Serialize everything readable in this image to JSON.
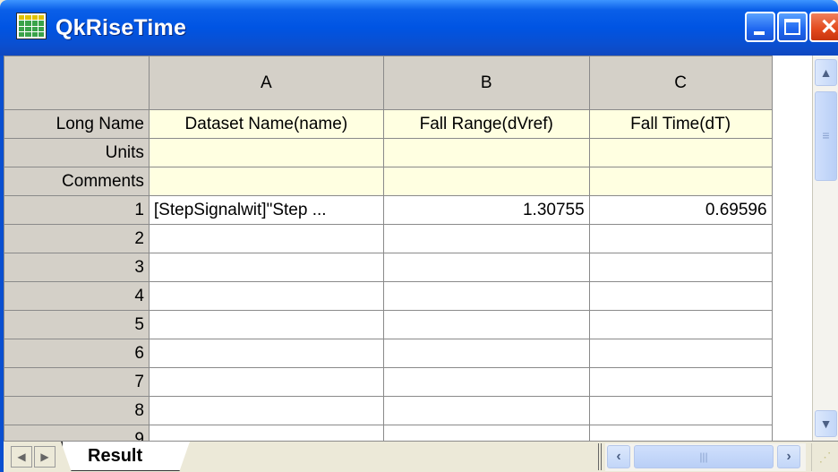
{
  "window": {
    "title": "QkRiseTime",
    "icon": "worksheet-icon",
    "controls": {
      "minimize": "minimize-icon",
      "maximize": "maximize-icon",
      "close": "close-icon",
      "close_glyph": "✕"
    }
  },
  "columns": [
    {
      "letter": "A",
      "long_name": "Dataset Name(name)",
      "units": "",
      "comments": ""
    },
    {
      "letter": "B",
      "long_name": "Fall Range(dVref)",
      "units": "",
      "comments": ""
    },
    {
      "letter": "C",
      "long_name": "Fall Time(dT)",
      "units": "",
      "comments": ""
    }
  ],
  "row_labels": {
    "long_name": "Long Name",
    "units": "Units",
    "comments": "Comments"
  },
  "rows": [
    {
      "index": "1",
      "cells": [
        "[StepSignalwit]\"Step ...",
        "1.30755",
        "0.69596"
      ]
    },
    {
      "index": "2",
      "cells": [
        "",
        "",
        ""
      ]
    },
    {
      "index": "3",
      "cells": [
        "",
        "",
        ""
      ]
    },
    {
      "index": "4",
      "cells": [
        "",
        "",
        ""
      ]
    },
    {
      "index": "5",
      "cells": [
        "",
        "",
        ""
      ]
    },
    {
      "index": "6",
      "cells": [
        "",
        "",
        ""
      ]
    },
    {
      "index": "7",
      "cells": [
        "",
        "",
        ""
      ]
    },
    {
      "index": "8",
      "cells": [
        "",
        "",
        ""
      ]
    },
    {
      "index": "9",
      "cells": [
        "",
        "",
        ""
      ]
    }
  ],
  "sheet_tabs": [
    {
      "label": "Result",
      "active": true
    }
  ],
  "colors": {
    "titlebar": "#0054e3",
    "header_bg": "#d4d0c8",
    "meta_row_bg": "#ffffe1",
    "close_button": "#e2481c"
  }
}
